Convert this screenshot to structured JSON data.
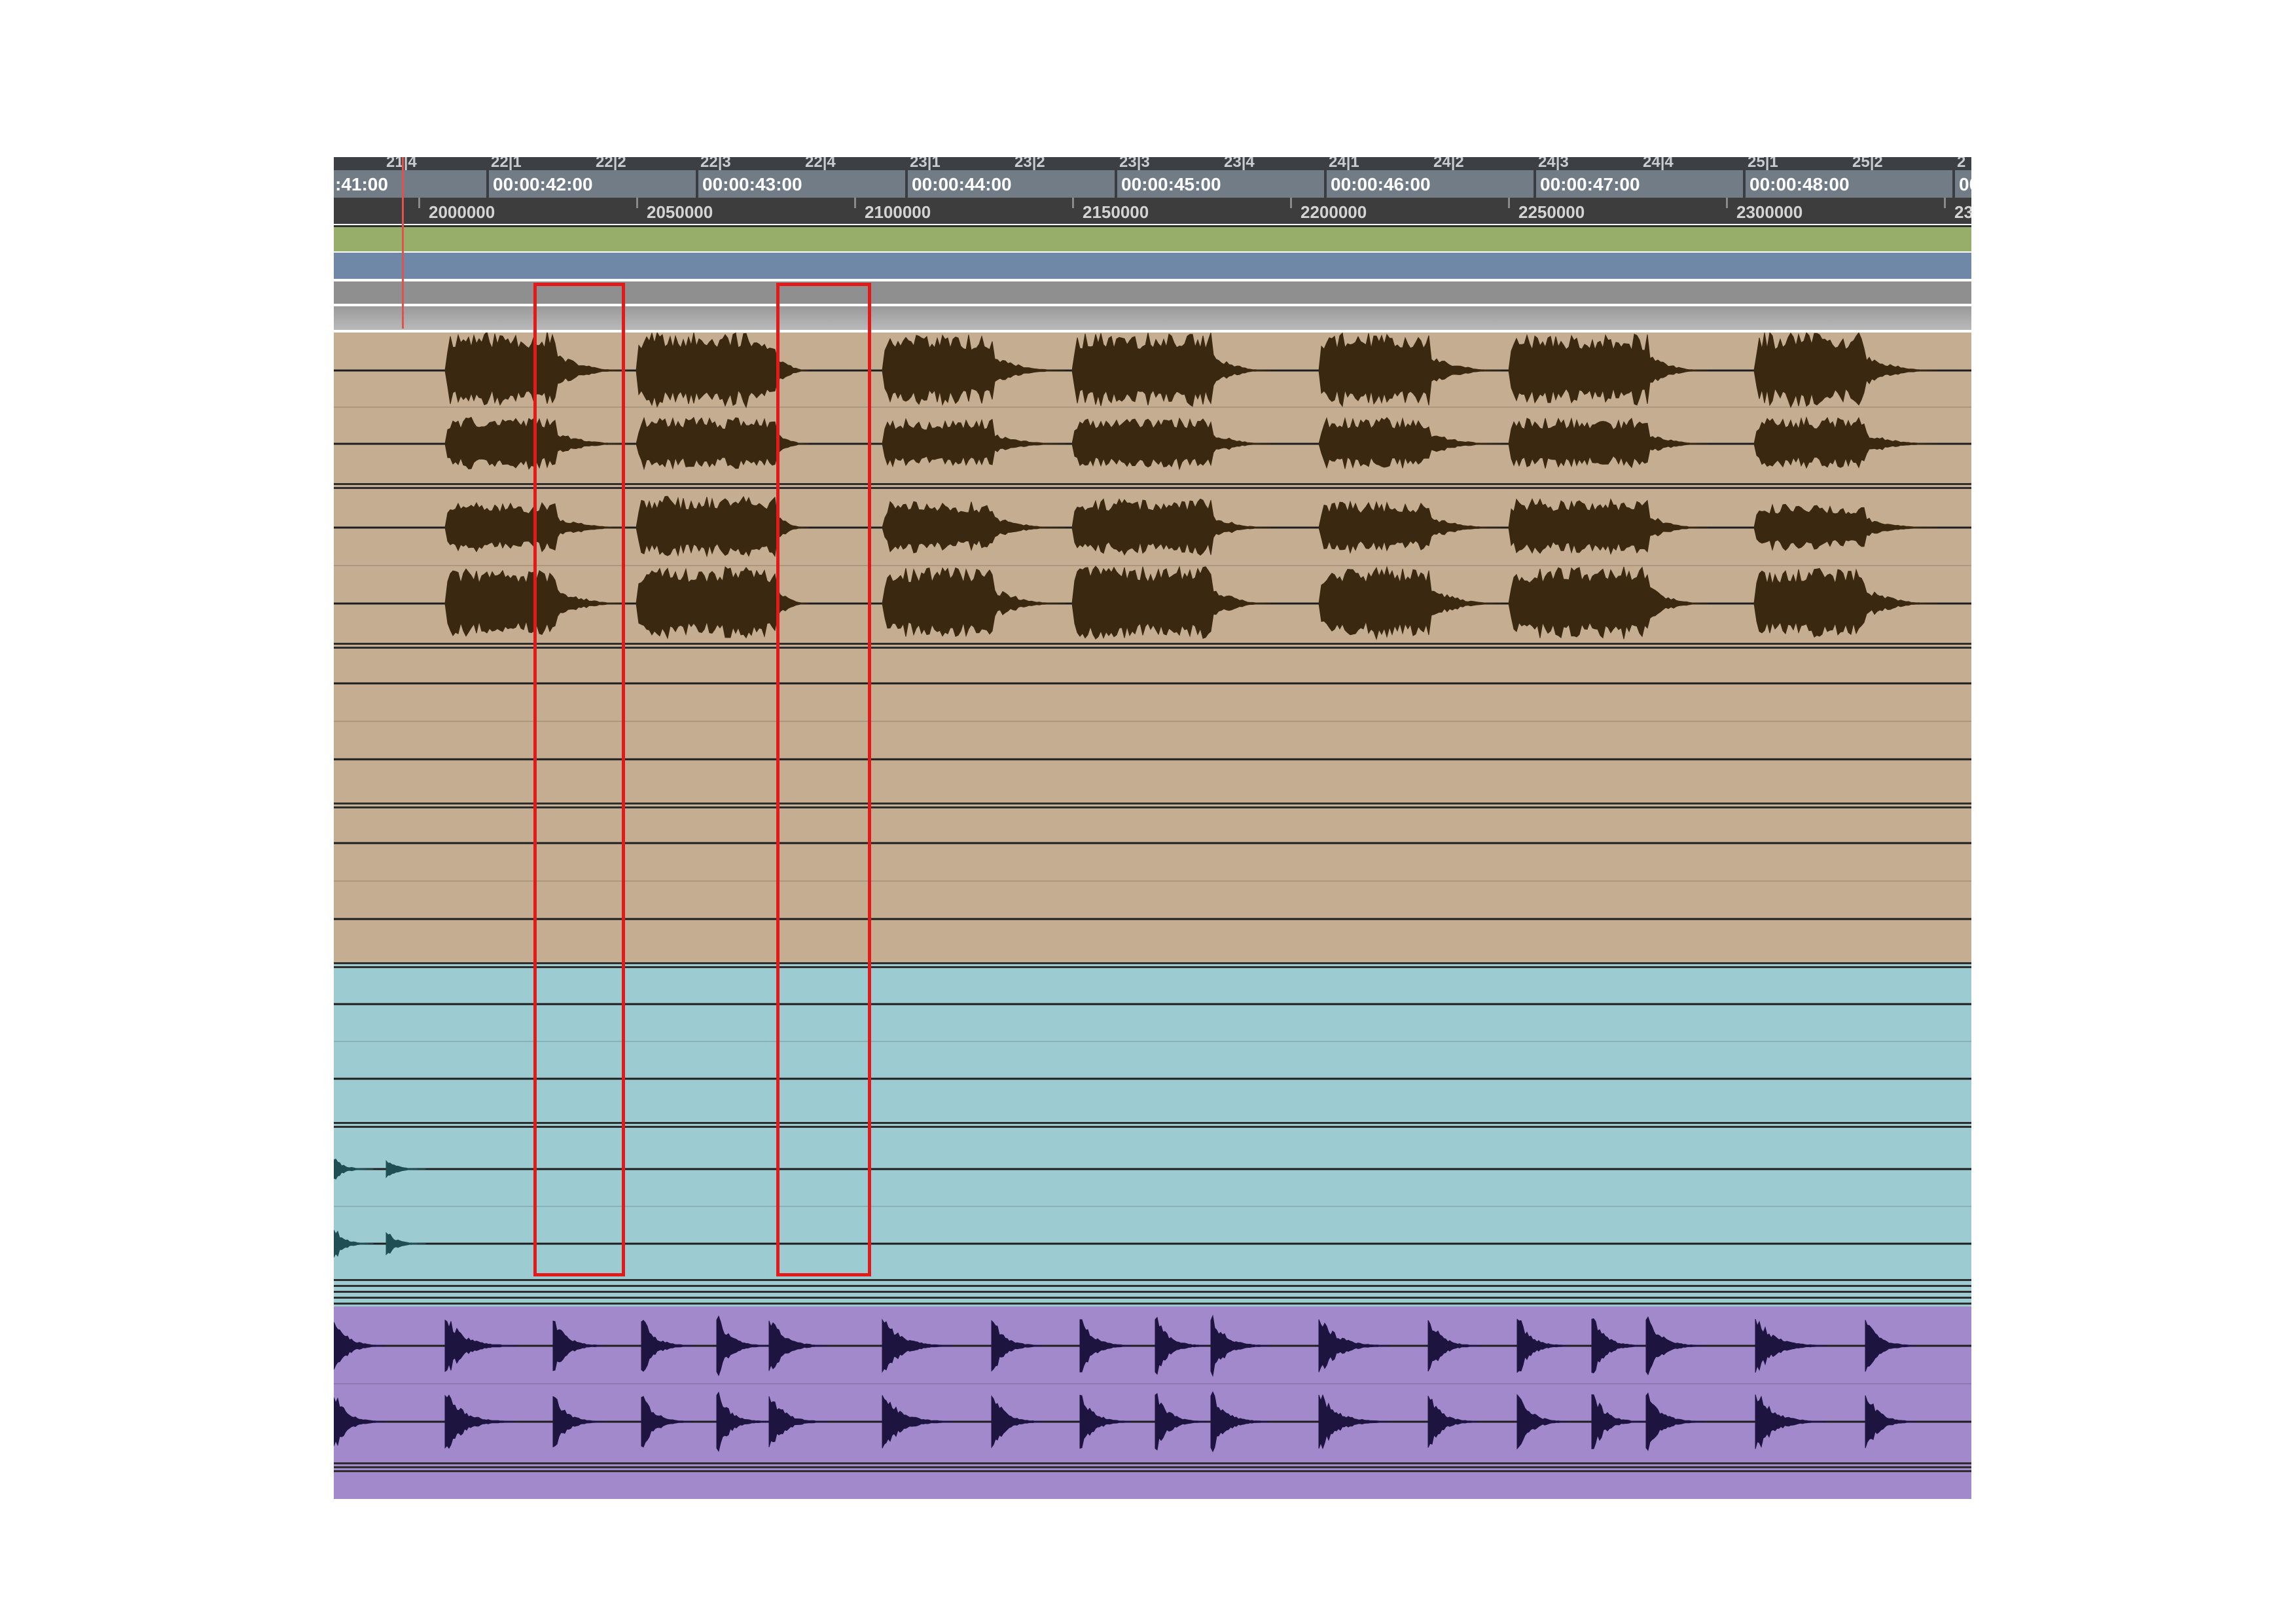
{
  "ruler": {
    "bar_labels": [
      "21|4",
      "22|1",
      "22|2",
      "22|3",
      "22|4",
      "23|1",
      "23|2",
      "23|3",
      "23|4",
      "24|1",
      "24|2",
      "24|3",
      "24|4",
      "25|1",
      "25|2",
      "2"
    ],
    "timecodes": [
      ":41:00",
      "00:00:42:00",
      "00:00:43:00",
      "00:00:44:00",
      "00:00:45:00",
      "00:00:46:00",
      "00:00:47:00",
      "00:00:48:00",
      "00"
    ],
    "samples": [
      "2000000",
      "2050000",
      "2100000",
      "2150000",
      "2200000",
      "2250000",
      "2300000",
      "23"
    ]
  },
  "colors": {
    "marker_lane": "#97ad6a",
    "tempo_lane": "#6f88a8",
    "gray_lane": "#8f8f8f",
    "tan_clip": "#c4ad91",
    "tan_wave": "#3b2810",
    "cyan_clip": "#9ccbd1",
    "cyan_wave": "#1f4f55",
    "purple_clip": "#a289cc",
    "purple_wave": "#1d1540",
    "selection": "#e21a1a",
    "playhead": "#e0524a"
  },
  "selection_boxes": [
    {
      "name": "selection-box-1"
    },
    {
      "name": "selection-box-2"
    }
  ]
}
